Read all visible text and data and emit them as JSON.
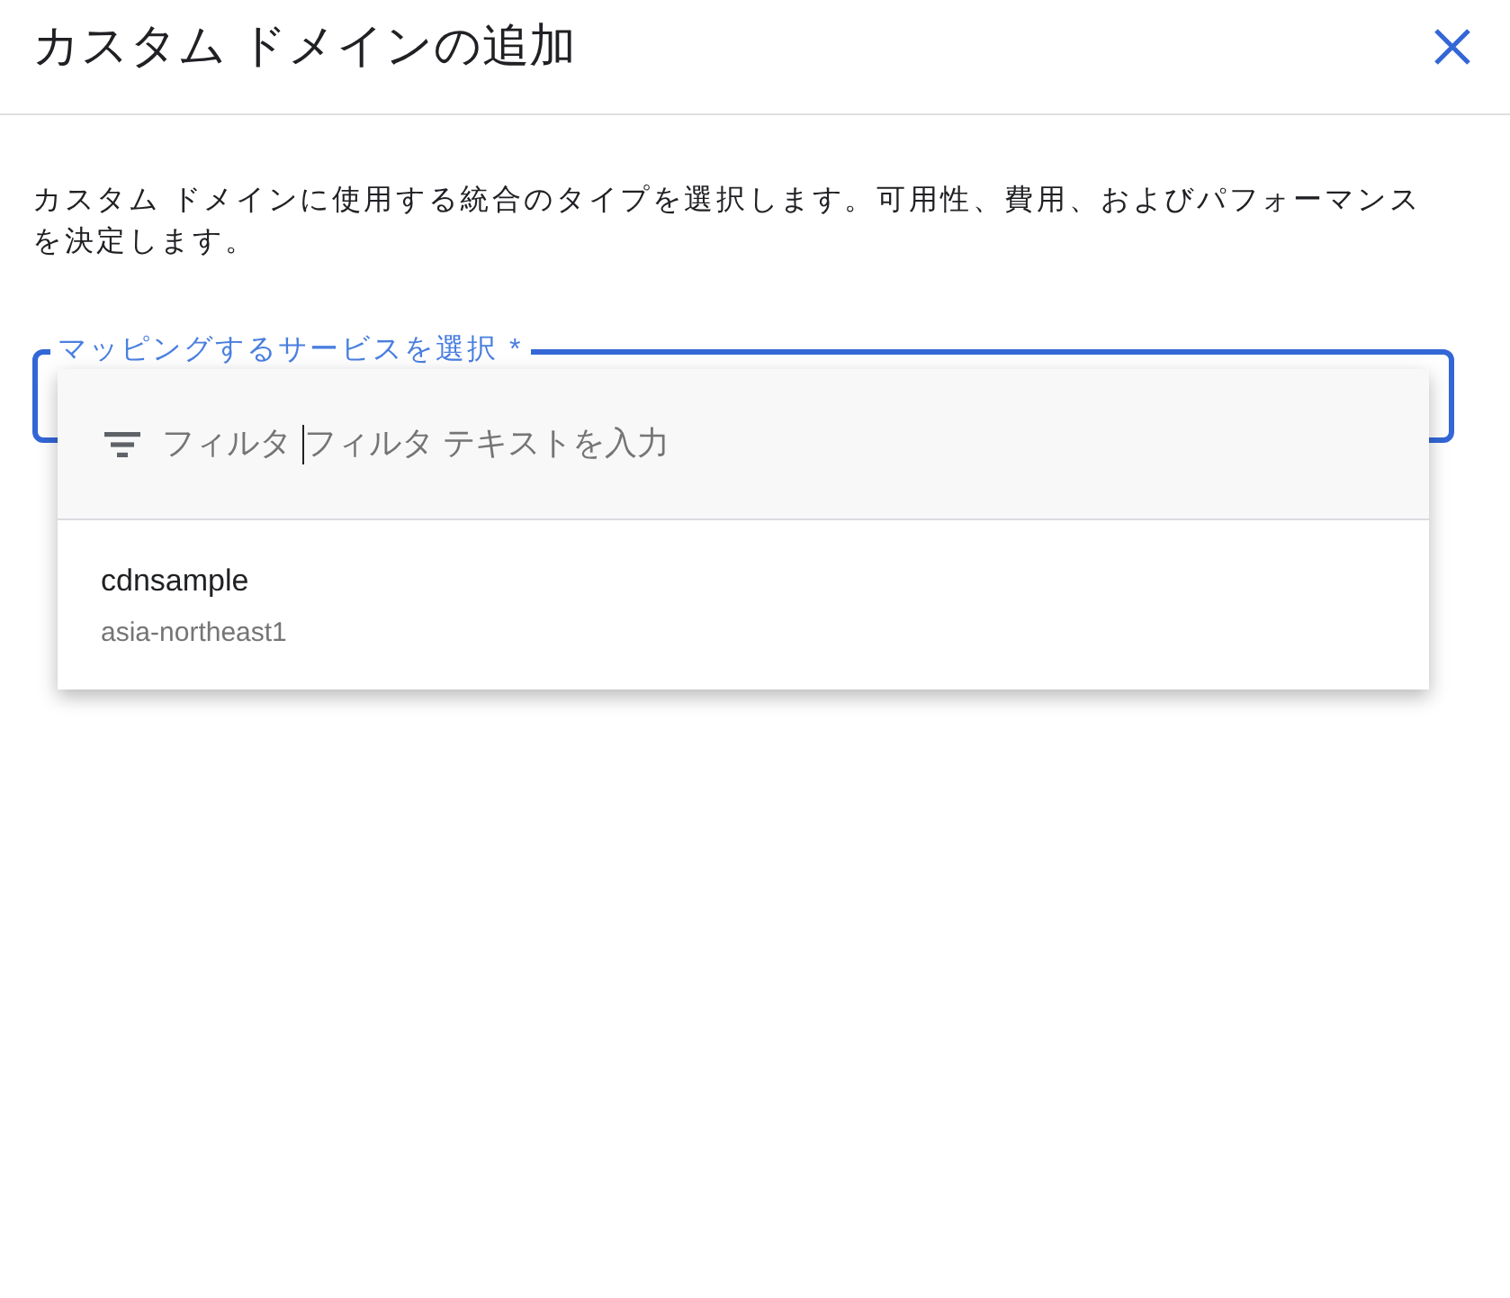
{
  "dialog": {
    "title": "カスタム ドメインの追加",
    "description": "カスタム ドメインに使用する統合のタイプを選択します。可用性、費用、およびパフォーマンスを決定します。"
  },
  "service_field": {
    "label": "マッピングするサービスを選択 *",
    "focused": true
  },
  "dropdown": {
    "filter": {
      "label": "フィルタ",
      "placeholder": "フィルタ テキストを入力",
      "focused": true
    },
    "options": [
      {
        "name": "cdnsample",
        "region": "asia-northeast1",
        "selected": false
      }
    ]
  }
}
